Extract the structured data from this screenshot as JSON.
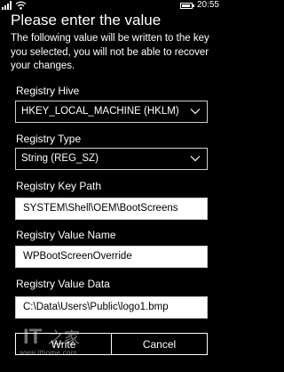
{
  "status_bar": {
    "time": "20:55",
    "icons": [
      "signal-icon",
      "wifi-icon",
      "battery-icon"
    ]
  },
  "dialog": {
    "title": "Please enter the value",
    "description": "The following value will be written to the key you selected, you will not be able to recover your changes."
  },
  "fields": {
    "hive": {
      "label": "Registry Hive",
      "value": "HKEY_LOCAL_MACHINE (HKLM)"
    },
    "type": {
      "label": "Registry Type",
      "value": "String (REG_SZ)"
    },
    "key_path": {
      "label": "Registry Key Path",
      "value": "SYSTEM\\Shell\\OEM\\BootScreens"
    },
    "value_name": {
      "label": "Registry Value Name",
      "value": "WPBootScreenOverride"
    },
    "value_data": {
      "label": "Registry Value Data",
      "value": "C:\\Data\\Users\\Public\\logo1.bmp"
    }
  },
  "buttons": {
    "write": "Write",
    "cancel": "Cancel"
  },
  "watermark": {
    "logo_text": "IT之家",
    "url": "www.ithome.com"
  },
  "colors": {
    "background": "#000000",
    "text": "#ffffff",
    "input_background": "#ffffff",
    "input_text": "#000000",
    "border": "#d0d0d0"
  }
}
